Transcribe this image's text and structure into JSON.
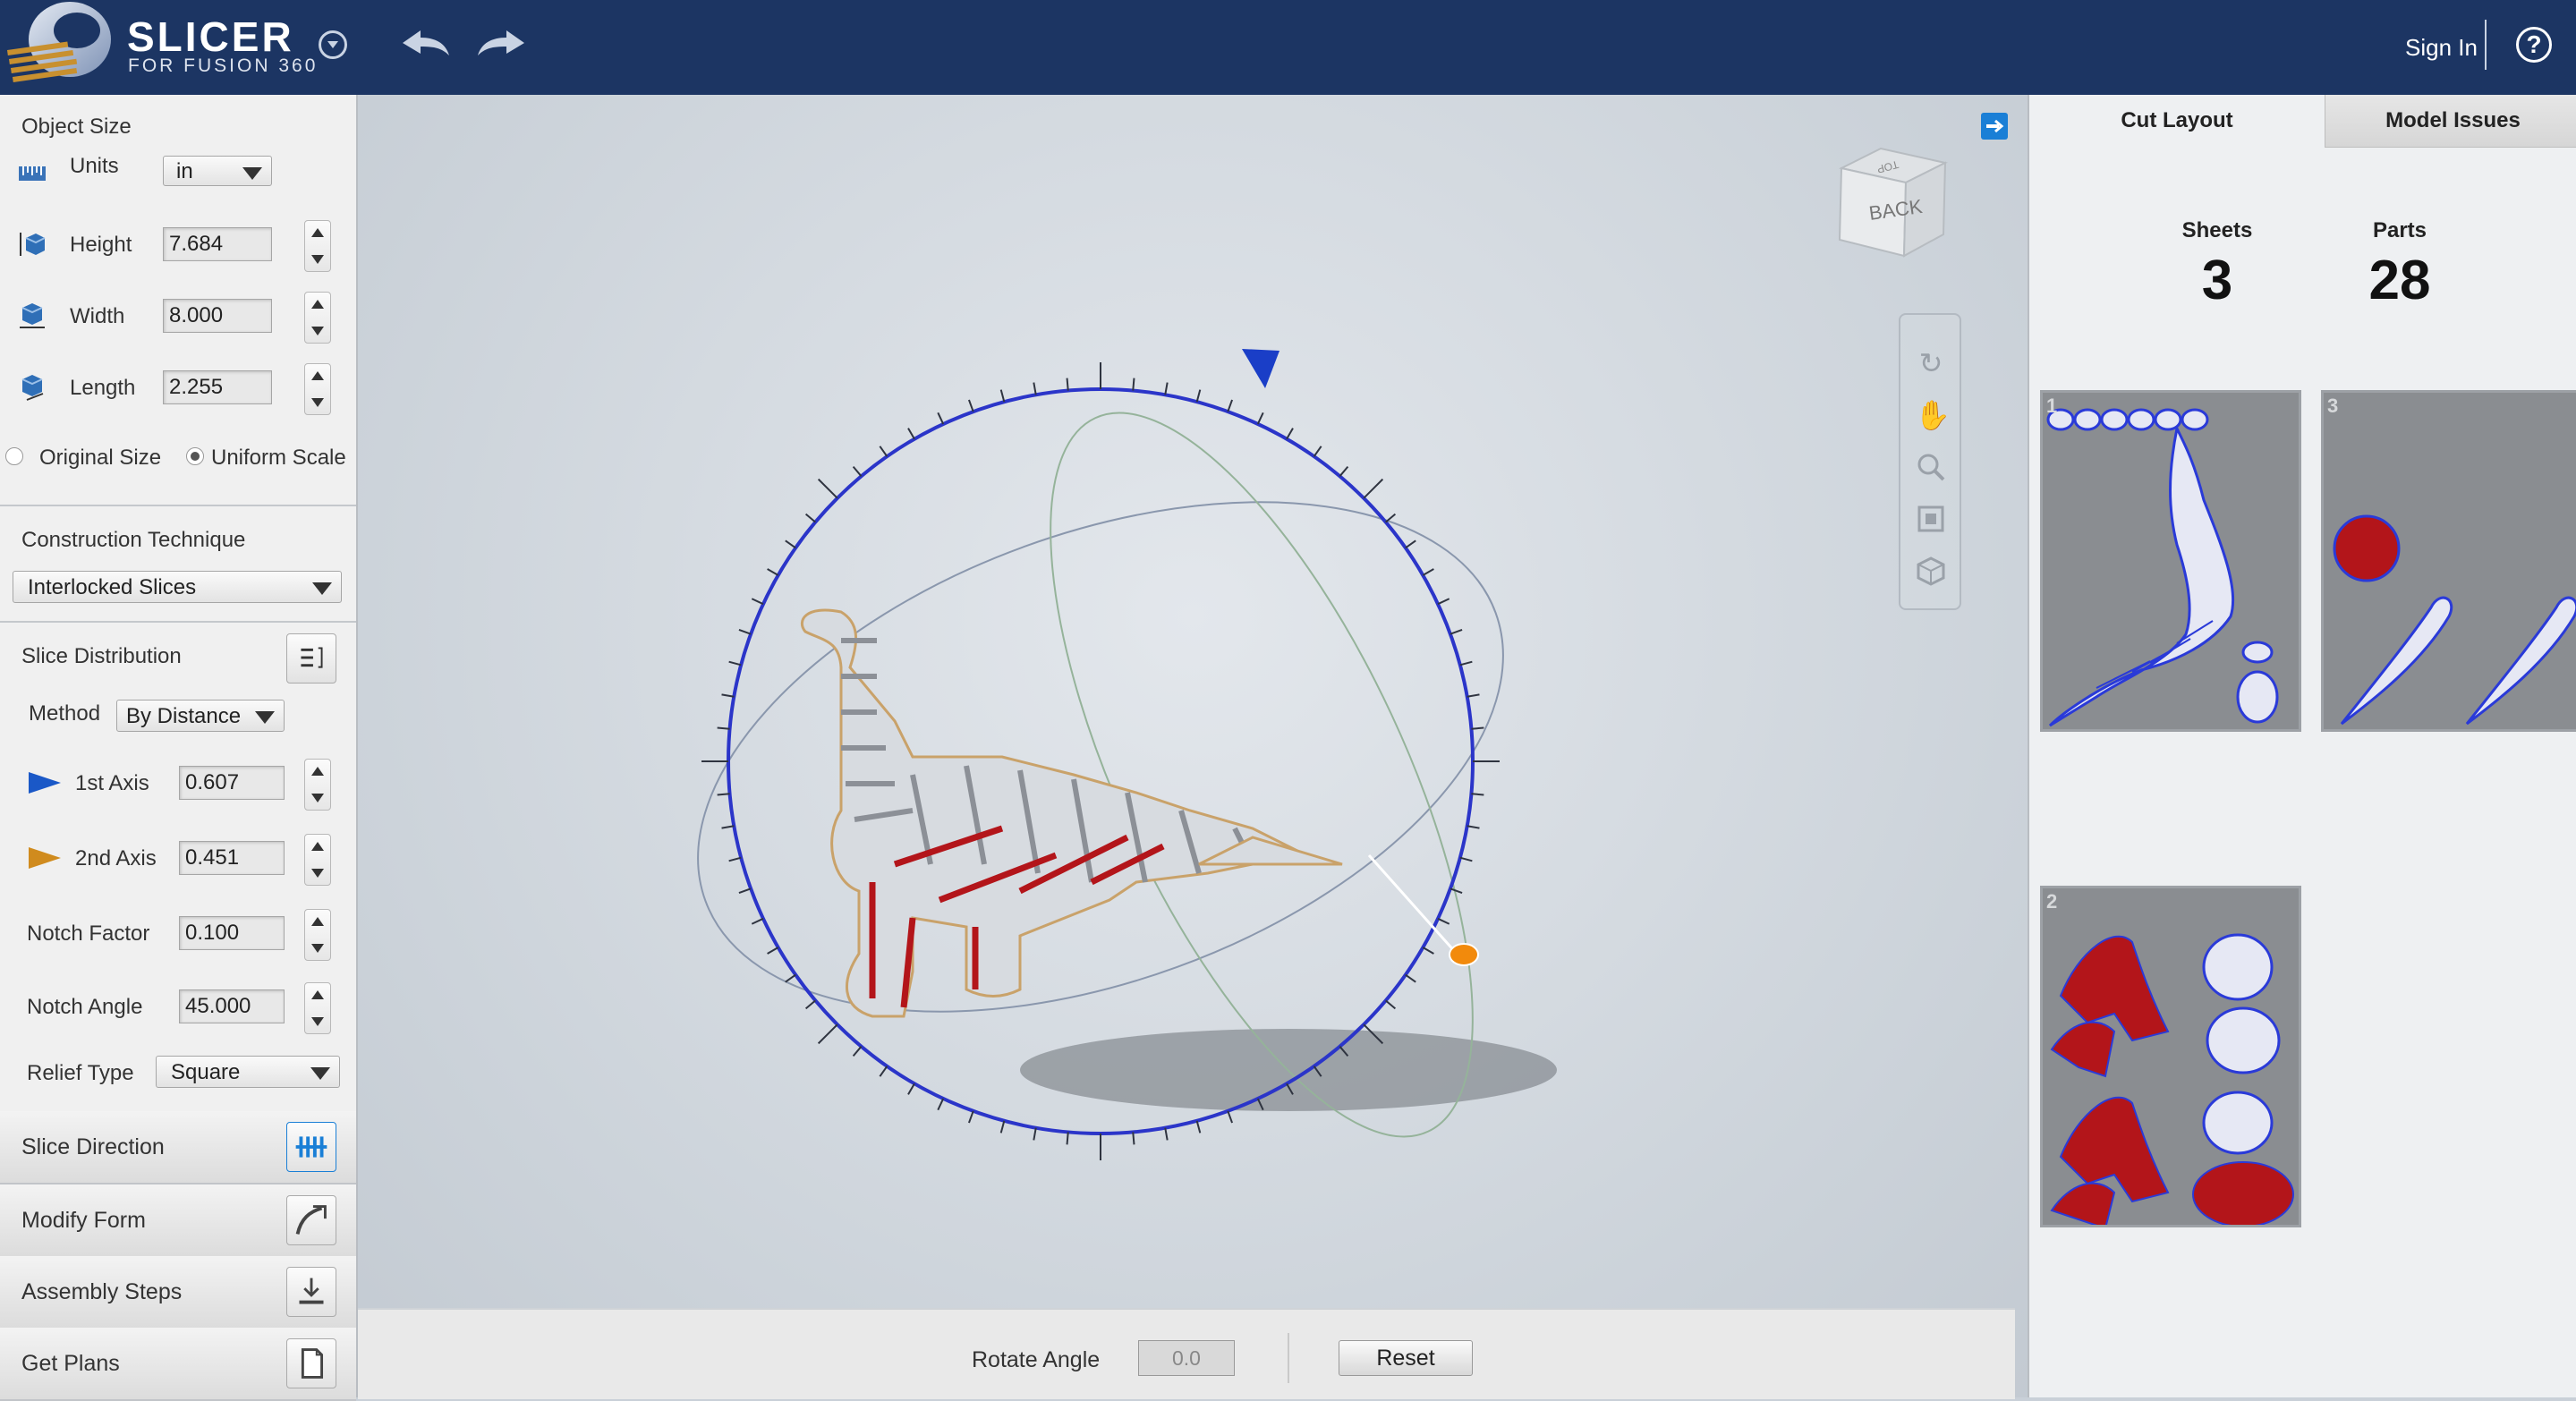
{
  "app": {
    "title": "SLICER",
    "subtitle": "FOR FUSION 360"
  },
  "topbar": {
    "sign_in": "Sign In",
    "help": "?"
  },
  "object_size": {
    "heading": "Object Size",
    "units_label": "Units",
    "units_value": "in",
    "height_label": "Height",
    "height_value": "7.684",
    "width_label": "Width",
    "width_value": "8.000",
    "length_label": "Length",
    "length_value": "2.255",
    "original_size_label": "Original Size",
    "uniform_scale_label": "Uniform Scale"
  },
  "construction": {
    "heading": "Construction Technique",
    "value": "Interlocked Slices"
  },
  "slice_distribution": {
    "heading": "Slice Distribution",
    "method_label": "Method",
    "method_value": "By Distance",
    "axis1_label": "1st Axis",
    "axis1_value": "0.607",
    "axis2_label": "2nd Axis",
    "axis2_value": "0.451",
    "notch_factor_label": "Notch Factor",
    "notch_factor_value": "0.100",
    "notch_angle_label": "Notch Angle",
    "notch_angle_value": "45.000",
    "relief_type_label": "Relief Type",
    "relief_type_value": "Square"
  },
  "steps": {
    "slice_direction": "Slice Direction",
    "modify_form": "Modify Form",
    "assembly_steps": "Assembly Steps",
    "get_plans": "Get Plans"
  },
  "viewport": {
    "view_cube_face": "BACK",
    "view_cube_top": "TOP",
    "rotate_angle_label": "Rotate Angle",
    "rotate_angle_value": "0.0",
    "reset_label": "Reset"
  },
  "right_panel": {
    "tab_cut_layout": "Cut Layout",
    "tab_model_issues": "Model Issues",
    "sheets_label": "Sheets",
    "sheets_value": "3",
    "parts_label": "Parts",
    "parts_value": "28",
    "sheet_numbers": [
      "1",
      "3",
      "2"
    ]
  },
  "colors": {
    "topbar": "#1c3563",
    "accent_blue": "#1a7fd6",
    "slice_red": "#b3151a",
    "gizmo_blue": "#2b35c9",
    "gizmo_orange": "#f28a0c"
  }
}
